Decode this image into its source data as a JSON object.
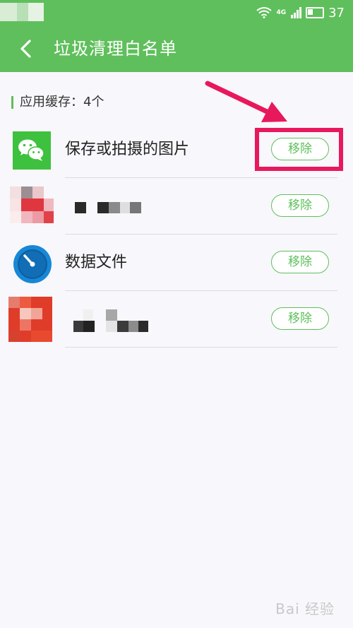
{
  "status_bar": {
    "network_type": "4G",
    "battery_level": "37"
  },
  "app_bar": {
    "title": "垃圾清理白名单"
  },
  "section": {
    "label": "应用缓存：4个"
  },
  "items": [
    {
      "label": "保存或拍摄的图片",
      "icon": "wechat-icon",
      "button": "移除",
      "highlighted": true
    },
    {
      "label": "",
      "icon": "blurred-app-icon",
      "button": "移除",
      "highlighted": false
    },
    {
      "label": "数据文件",
      "icon": "speedometer-icon",
      "button": "移除",
      "highlighted": false
    },
    {
      "label": "",
      "icon": "blurred-app-icon",
      "button": "移除",
      "highlighted": false
    }
  ],
  "colors": {
    "header_green": "#5fbf5c",
    "annotation_pink": "#e8185c",
    "background": "#f8f7fb"
  },
  "watermark": {
    "text": "Bai 经验"
  }
}
